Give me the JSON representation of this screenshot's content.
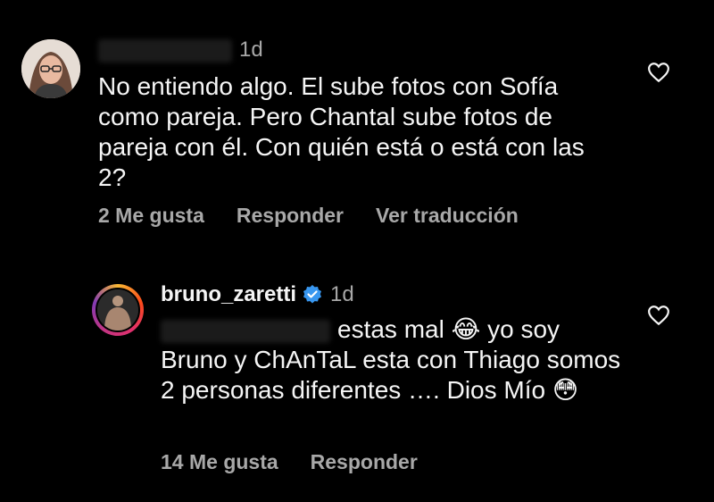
{
  "comment1": {
    "time": "1d",
    "text": "No entiendo algo. El sube fotos con Sofía como pareja. Pero Chantal sube fotos de pareja con él. Con quién está o está con las 2?",
    "likes": "2 Me gusta",
    "reply": "Responder",
    "translate": "Ver traducción"
  },
  "comment2": {
    "username": "bruno_zaretti",
    "time": "1d",
    "text": "estas mal 😂 yo soy Bruno y ChAnTaL esta con Thiago somos 2 personas diferentes …. Dios Mío 😳",
    "likes": "14 Me gusta",
    "reply": "Responder"
  },
  "icons": {
    "heart": "heart-outline-icon",
    "verified": "verified-badge-icon",
    "accent": "#3897f0"
  }
}
